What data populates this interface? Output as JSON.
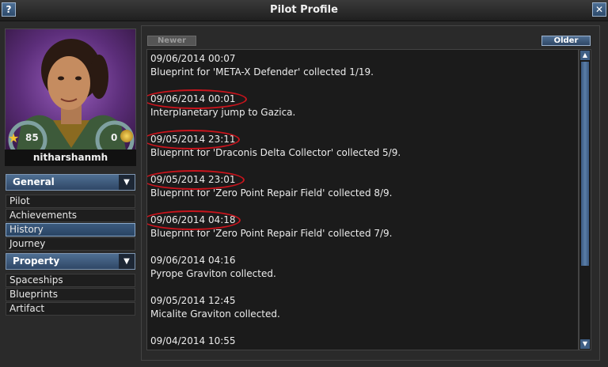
{
  "window": {
    "title": "Pilot Profile",
    "help_label": "?",
    "close_label": "✕"
  },
  "profile": {
    "name": "nitharshanmh",
    "rank_value": "85",
    "medal_value": "0"
  },
  "sidebar": {
    "general": {
      "label": "General",
      "arrow": "▼",
      "items": [
        {
          "label": "Pilot"
        },
        {
          "label": "Achievements"
        },
        {
          "label": "History",
          "selected": true
        },
        {
          "label": "Journey"
        }
      ]
    },
    "property": {
      "label": "Property",
      "arrow": "▼",
      "items": [
        {
          "label": "Spaceships"
        },
        {
          "label": "Blueprints"
        },
        {
          "label": "Artifact"
        }
      ]
    }
  },
  "history": {
    "newer_label": "Newer",
    "older_label": "Older",
    "entries": [
      {
        "date": "09/06/2014 00:07",
        "text": "Blueprint for 'META-X Defender' collected 1/19.",
        "highlighted": false
      },
      {
        "date": "09/06/2014 00:01",
        "text": "Interplanetary jump to Gazica.",
        "highlighted": true
      },
      {
        "date": "09/05/2014 23:11",
        "text": "Blueprint for 'Draconis Delta Collector' collected 5/9.",
        "highlighted": true
      },
      {
        "date": "09/05/2014 23:01",
        "text": "Blueprint for 'Zero Point Repair Field' collected 8/9.",
        "highlighted": true
      },
      {
        "date": "09/06/2014 04:18",
        "text": "Blueprint for 'Zero Point Repair Field' collected 7/9.",
        "highlighted": true
      },
      {
        "date": "09/06/2014 04:16",
        "text": "Pyrope Graviton collected.",
        "highlighted": false
      },
      {
        "date": "09/05/2014 12:45",
        "text": "Micalite Graviton collected.",
        "highlighted": false
      },
      {
        "date": "09/04/2014 10:55",
        "text": "",
        "highlighted": false
      }
    ]
  },
  "colors": {
    "highlight_circle": "#c8141c",
    "accent": "#3f5f85"
  },
  "icons": {
    "rank": "star-icon",
    "medal": "medal-icon",
    "scroll_up": "triangle-up-icon",
    "scroll_down": "triangle-down-icon"
  }
}
